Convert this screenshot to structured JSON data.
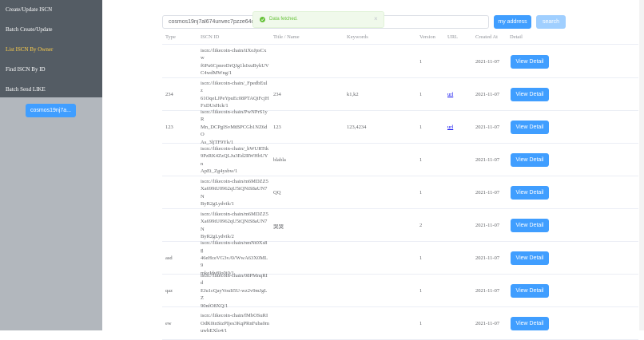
{
  "sidebar": {
    "items": [
      {
        "label": "Create/Update ISCN"
      },
      {
        "label": "Batch Create/Update"
      },
      {
        "label": "List ISCN By Owner"
      },
      {
        "label": "Find ISCN By ID"
      },
      {
        "label": "Batch Send LIKE"
      }
    ],
    "active_index": 2,
    "address_button": "cosmos19nj7a..."
  },
  "toolbar": {
    "search_value": "cosmos19nj7al674unvec7pzze64cq6el",
    "my_address_label": "my address",
    "search_label": "search"
  },
  "toast": {
    "message": "Data fetched.",
    "close_glyph": "×"
  },
  "table": {
    "headers": {
      "type": "Type",
      "iscn_id": "ISCN ID",
      "title": "Title / Name",
      "keywords": "Keywords",
      "version": "Version",
      "url": "URL",
      "created_at": "Created At",
      "detail": "Detail"
    },
    "detail_button_label": "View Detail",
    "rows": [
      {
        "type": "",
        "iscn_id": "iscn://likecoin-chain/iiXoJpsCxw\nf6Pu6CpnroDrQJg1lsIxuBykUV\nC4wdMWng/1",
        "title": "",
        "keywords": "",
        "version": "1",
        "url": "",
        "created_at": "2021-11-07"
      },
      {
        "type": "234",
        "iscn_id": "iscn://likecoin-chain/_FpedbEulz\n61OqeLJPeYpuEc08PTAQiFcjH\nFxDUsHck/1",
        "title": "234",
        "keywords": "k1,k2",
        "version": "1",
        "url": "url",
        "created_at": "2021-11-07"
      },
      {
        "type": "123",
        "iscn_id": "iscn://likecoin-chain/PwNPrS1yR\nMn_DCPgISvMtBPCGb1NZ6dO\nAs_3ljTF9Yk/1",
        "title": "123",
        "keywords": "123,4234",
        "version": "1",
        "url": "url",
        "created_at": "2021-11-07"
      },
      {
        "type": "",
        "iscn_id": "iscn://likecoin-chain/_hWURTtk\n9PzRK4ZzQLJu3Ed2RWHbUYn\nApEi_Zg4ysbw/1",
        "title": "blabla",
        "keywords": "",
        "version": "1",
        "url": "",
        "created_at": "2021-11-07"
      },
      {
        "type": "",
        "iscn_id": "iscn://likecoin-chain/m6MDZZ5\nXa699tU0962qU5tQNiS8aUN7N\nByR2gLydvik/1",
        "title": "QQ",
        "keywords": "",
        "version": "1",
        "url": "",
        "created_at": "2021-11-07"
      },
      {
        "type": "",
        "iscn_id": "iscn://likecoin-chain/m6MDZZ5\nXa699tU0962qU5tQNiS8aUN7N\nByR2gLydvik/2",
        "title": "哭哭",
        "keywords": "",
        "version": "2",
        "url": "",
        "created_at": "2021-11-07"
      },
      {
        "type": "asd",
        "iscn_id": "iscn://likecoin-chain/nmNt0Xs8g\n46eHceVG3vAVWwA63X0ML9\nmkeIdv8Io0i0/1",
        "title": "",
        "keywords": "",
        "version": "1",
        "url": "",
        "created_at": "2021-11-07"
      },
      {
        "type": "qaz",
        "iscn_id": "iscn://likecoin-chain/08PMnqRId\nEJu1cQayVouIi5U-wz2v9mJgLZ\n90nfO8XQ/1",
        "title": "",
        "keywords": "",
        "version": "1",
        "url": "",
        "created_at": "2021-11-07"
      },
      {
        "type": "ew",
        "iscn_id": "iscn://likecoin-chain/fMbOSuRI\nOdK0inSizPIjes3KqPRnFuba0m\nuwbEXlo4/1",
        "title": "",
        "keywords": "",
        "version": "1",
        "url": "",
        "created_at": "2021-11-07"
      }
    ]
  },
  "colors": {
    "sidebar_bg": "#545c64",
    "active_menu": "#ffd04b",
    "primary": "#409eff",
    "success": "#67c23a"
  }
}
